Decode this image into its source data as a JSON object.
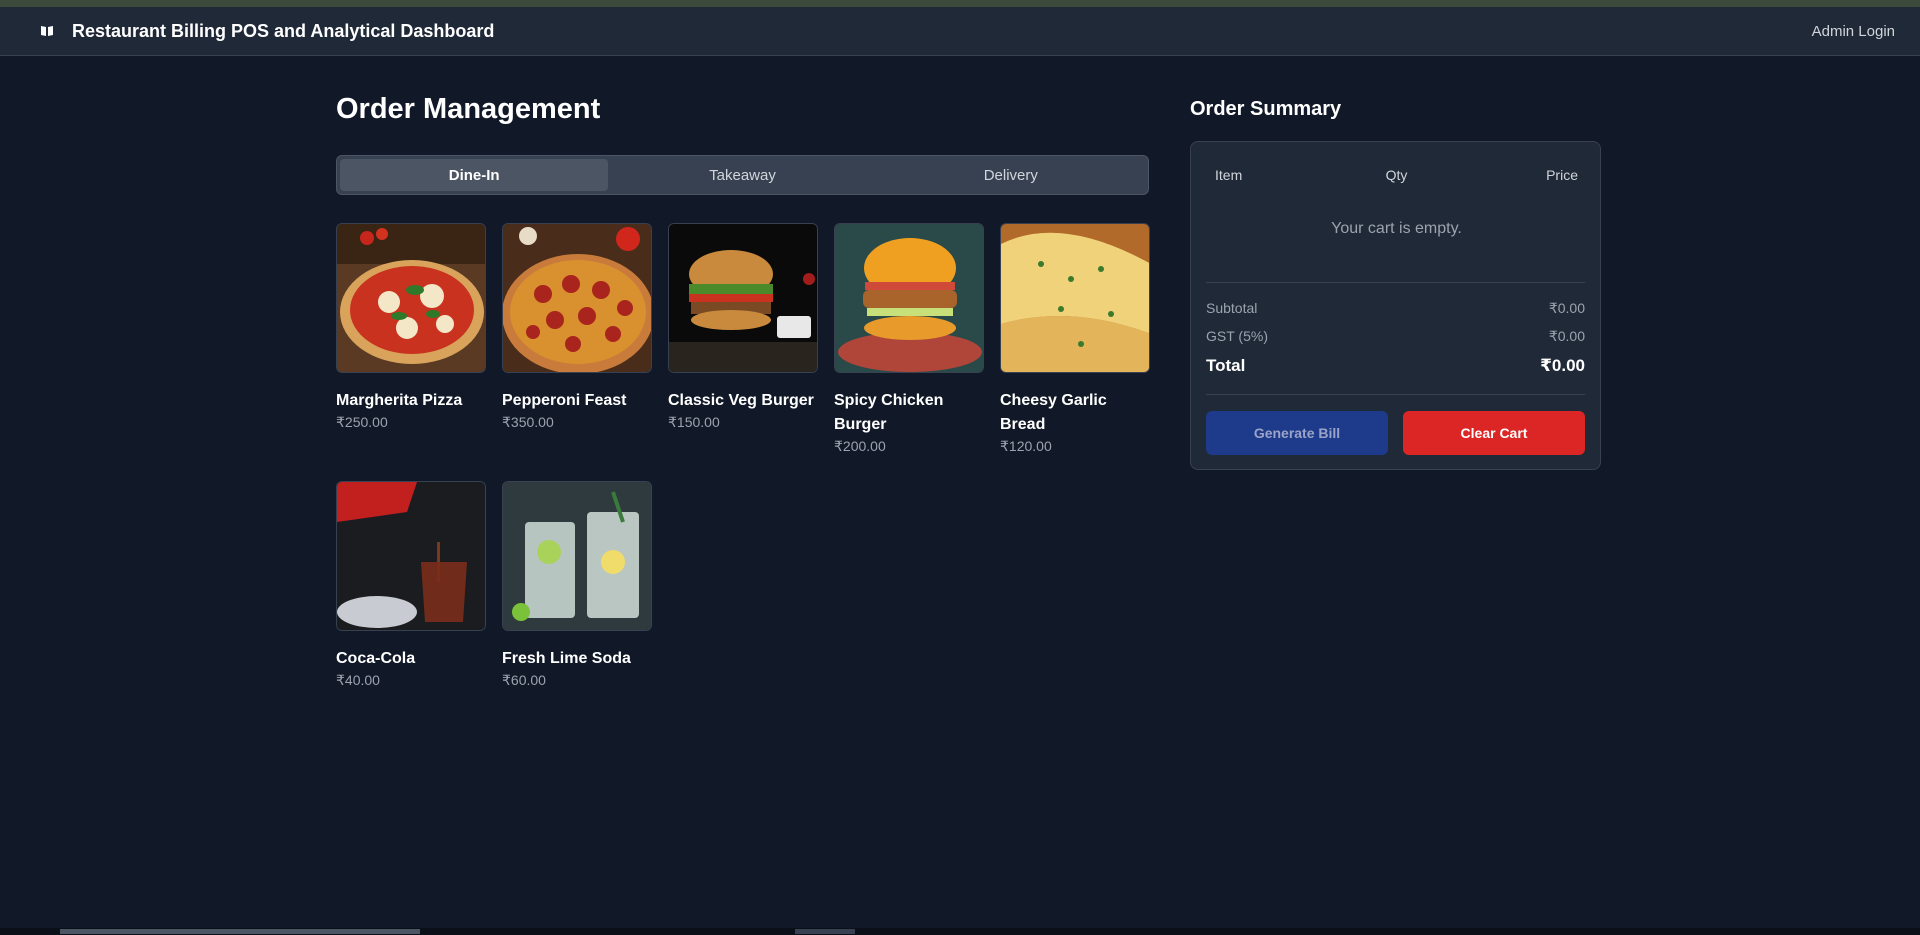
{
  "app": {
    "title": "Restaurant Billing POS and Analytical Dashboard",
    "admin_link": "Admin Login"
  },
  "order": {
    "title": "Order Management",
    "tabs": [
      {
        "label": "Dine-In",
        "active": true
      },
      {
        "label": "Takeaway",
        "active": false
      },
      {
        "label": "Delivery",
        "active": false
      }
    ],
    "items": [
      {
        "name": "Margherita Pizza",
        "price": "₹250.00"
      },
      {
        "name": "Pepperoni Feast",
        "price": "₹350.00"
      },
      {
        "name": "Classic Veg Burger",
        "price": "₹150.00"
      },
      {
        "name": "Spicy Chicken Burger",
        "price": "₹200.00"
      },
      {
        "name": "Cheesy Garlic Bread",
        "price": "₹120.00"
      },
      {
        "name": "Coca-Cola",
        "price": "₹40.00"
      },
      {
        "name": "Fresh Lime Soda",
        "price": "₹60.00"
      }
    ]
  },
  "summary": {
    "title": "Order Summary",
    "columns": [
      "Item",
      "Qty",
      "Price"
    ],
    "empty_message": "Your cart is empty.",
    "subtotal_label": "Subtotal",
    "subtotal_value": "₹0.00",
    "gst_label": "GST (5%)",
    "gst_value": "₹0.00",
    "total_label": "Total",
    "total_value": "₹0.00",
    "generate_bill_label": "Generate Bill",
    "clear_cart_label": "Clear Cart"
  },
  "colors": {
    "background": "#111827",
    "panel": "#1f2937",
    "generate_bill": "#1e3a8a",
    "clear_cart": "#dc2626"
  }
}
